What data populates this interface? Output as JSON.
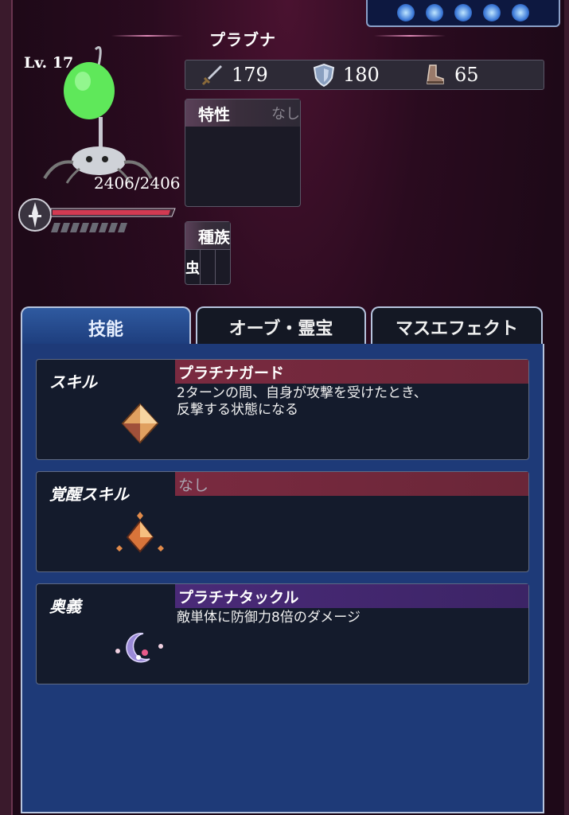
{
  "unit": {
    "name": "プラブナ",
    "level": "Lv. 17",
    "hp": "2406/2406",
    "hp_fraction": 1.0,
    "stats": [
      {
        "icon": "sword-icon",
        "value": "179"
      },
      {
        "icon": "shield-icon",
        "value": "180"
      },
      {
        "icon": "boot-icon",
        "value": "65"
      }
    ]
  },
  "trait": {
    "label": "特性",
    "value": "なし"
  },
  "tribe": {
    "label": "種族",
    "values": [
      "虫",
      "",
      ""
    ]
  },
  "tabs": [
    {
      "label": "技能",
      "active": true
    },
    {
      "label": "オーブ・霊宝",
      "active": false
    },
    {
      "label": "マスエフェクト",
      "active": false
    }
  ],
  "skills": [
    {
      "label": "スキル",
      "name": "プラチナガード",
      "desc_line1": "2ターンの間、自身が攻撃を受けたとき、",
      "desc_line2": "反撃する状態になる",
      "icon": "crystal-icon",
      "color": "#7a2a40"
    },
    {
      "label": "覚醒スキル",
      "name": "なし",
      "desc_line1": "",
      "desc_line2": "",
      "icon": "awakened-crystal-icon",
      "color": "#7a2a40"
    },
    {
      "label": "奥義",
      "name": "プラチナタックル",
      "desc_line1": "敵単体に防御力8倍のダメージ",
      "desc_line2": "",
      "icon": "moon-orb-icon",
      "color": "#4a2a78"
    }
  ]
}
